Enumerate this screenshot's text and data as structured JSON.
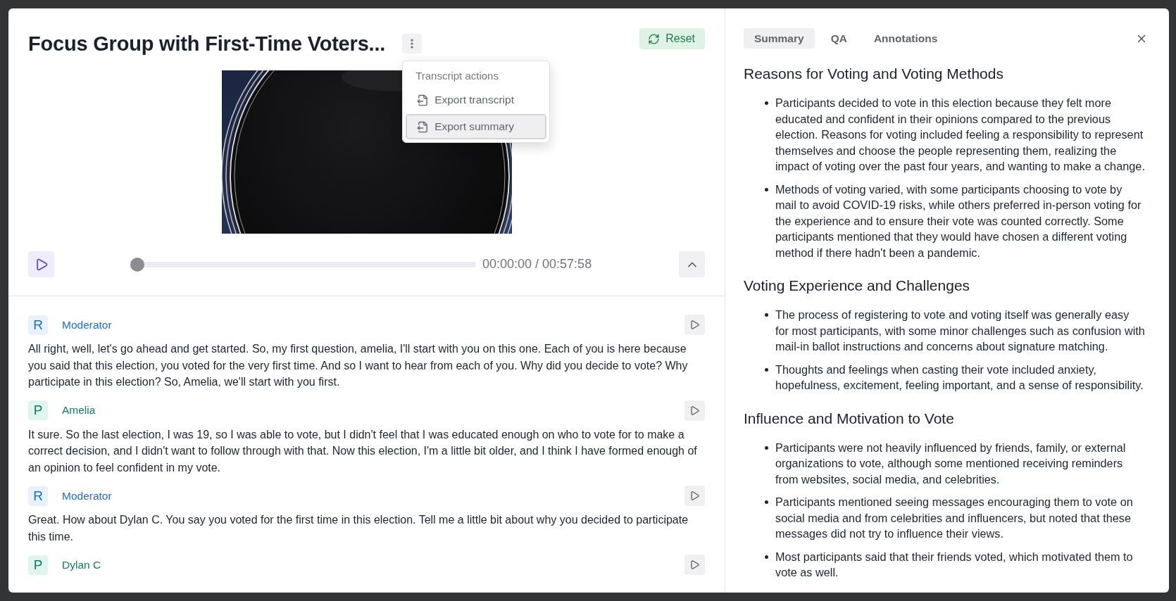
{
  "title": "Focus Group with First-Time Voters...",
  "reset_button": "Reset",
  "menu": {
    "heading": "Transcript actions",
    "items": [
      {
        "label": "Export transcript",
        "selected": false
      },
      {
        "label": "Export summary",
        "selected": true
      }
    ]
  },
  "player": {
    "level": 0,
    "time": "00:00:00 / 00:57:58"
  },
  "transcript": [
    {
      "kind": "moderator",
      "initial": "R",
      "speaker": "Moderator",
      "text": "All right, well, let's go ahead and get started. So, my first question, amelia, I'll start with you on this one. Each of you is here because you said that this election, you voted for the very first time. And so I want to hear from each of you. Why did you decide to vote? Why participate in this election? So, Amelia, we'll start with you first."
    },
    {
      "kind": "participant",
      "initial": "P",
      "speaker": "Amelia",
      "text": "It sure. So the last election, I was 19, so I was able to vote, but I didn't feel that I was educated enough on who to vote for to make a correct decision, and I didn't want to follow through with that. Now this election, I'm a little bit older, and I think I have formed enough of an opinion to feel confident in my vote."
    },
    {
      "kind": "moderator",
      "initial": "R",
      "speaker": "Moderator",
      "text": "Great. How about Dylan C. You say you voted for the first time in this election. Tell me a little bit about why you decided to participate this time."
    },
    {
      "kind": "participant",
      "initial": "P",
      "speaker": "Dylan C"
    }
  ],
  "tabs": [
    {
      "label": "Summary",
      "selected": true
    },
    {
      "label": "QA",
      "selected": false
    },
    {
      "label": "Annotations",
      "selected": false
    }
  ],
  "summary": [
    {
      "heading": "Reasons for Voting and Voting Methods",
      "bullets": [
        "Participants decided to vote in this election because they felt more educated and confident in their opinions compared to the previous election. Reasons for voting included feeling a responsibility to represent themselves and choose the people representing them, realizing the impact of voting over the past four years, and wanting to make a change.",
        "Methods of voting varied, with some participants choosing to vote by mail to avoid COVID-19 risks, while others preferred in-person voting for the experience and to ensure their vote was counted correctly. Some participants mentioned that they would have chosen a different voting method if there hadn't been a pandemic."
      ]
    },
    {
      "heading": "Voting Experience and Challenges",
      "bullets": [
        "The process of registering to vote and voting itself was generally easy for most participants, with some minor challenges such as confusion with mail-in ballot instructions and concerns about signature matching.",
        "Thoughts and feelings when casting their vote included anxiety, hopefulness, excitement, feeling important, and a sense of responsibility."
      ]
    },
    {
      "heading": "Influence and Motivation to Vote",
      "bullets": [
        "Participants were not heavily influenced by friends, family, or external organizations to vote, although some mentioned receiving reminders from websites, social media, and celebrities.",
        "Participants mentioned seeing messages encouraging them to vote on social media and from celebrities and influencers, but noted that these messages did not try to influence their views.",
        "Most participants said that their friends voted, which motivated them to vote as well."
      ]
    }
  ]
}
